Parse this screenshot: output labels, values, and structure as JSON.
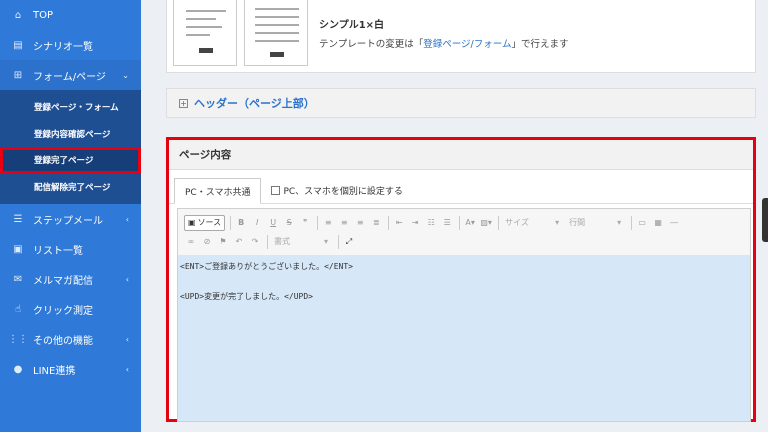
{
  "sidebar": {
    "items": [
      {
        "label": "TOP",
        "icon": "home-icon"
      },
      {
        "label": "シナリオ一覧",
        "icon": "list-icon"
      },
      {
        "label": "フォーム/ページ",
        "icon": "form-icon"
      },
      {
        "label": "ステップメール",
        "icon": "step-icon"
      },
      {
        "label": "リスト一覧",
        "icon": "list-box-icon"
      },
      {
        "label": "メルマガ配信",
        "icon": "mail-icon"
      },
      {
        "label": "クリック測定",
        "icon": "cursor-icon"
      },
      {
        "label": "その他の機能",
        "icon": "grid-icon"
      },
      {
        "label": "LINE連携",
        "icon": "chat-icon"
      }
    ],
    "submenu": [
      {
        "label": "登録ページ・フォーム"
      },
      {
        "label": "登録内容確認ページ"
      },
      {
        "label": "登録完了ページ"
      },
      {
        "label": "配信解除完了ページ"
      }
    ]
  },
  "template": {
    "name": "シンプル1×白",
    "desc_prefix": "テンプレートの変更は「",
    "desc_link": "登録ページ/フォーム",
    "desc_suffix": "」で行えます"
  },
  "header_section": {
    "label": "ヘッダー（ページ上部）"
  },
  "content_section": {
    "title": "ページ内容",
    "tabs": [
      {
        "label": "PC・スマホ共通"
      },
      {
        "label": "PC、スマホを個別に設定する"
      }
    ]
  },
  "editor": {
    "source_label": "ソース",
    "font_size_label": "サイズ",
    "line_height_label": "行間",
    "format_label": "書式",
    "lines": [
      "<ENT>ご登録ありがとうございました。</ENT>",
      "<UPD>変更が完了しました。</UPD>"
    ]
  },
  "colors": {
    "sidebar_bg": "#2f7ad9",
    "submenu_bg": "#1f4f93",
    "highlight": "#e60012",
    "link": "#2a73c9",
    "editor_area": "#d6e7f7"
  }
}
